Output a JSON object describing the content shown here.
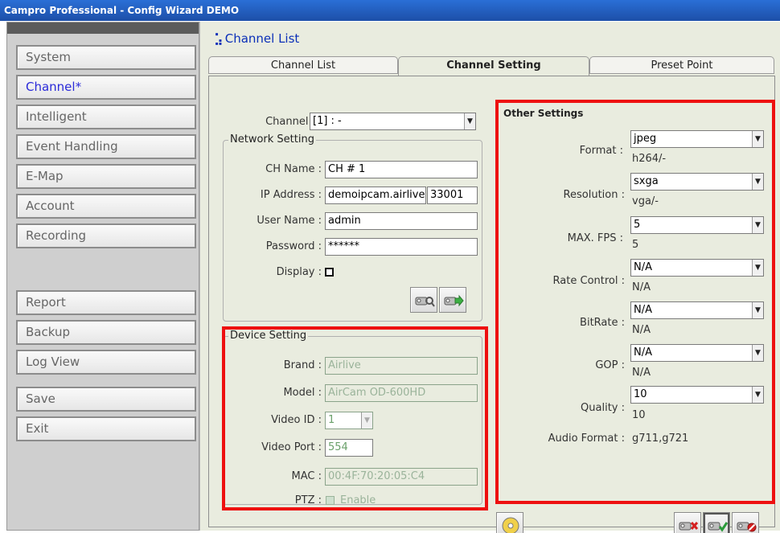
{
  "window": {
    "title": "Campro Professional - Config Wizard DEMO"
  },
  "sidebar": {
    "items": [
      {
        "label": "System"
      },
      {
        "label": "Channel*"
      },
      {
        "label": "Intelligent"
      },
      {
        "label": "Event Handling"
      },
      {
        "label": "E-Map"
      },
      {
        "label": "Account"
      },
      {
        "label": "Recording"
      },
      {
        "label": "Report"
      },
      {
        "label": "Backup"
      },
      {
        "label": "Log View"
      },
      {
        "label": "Save"
      },
      {
        "label": "Exit"
      }
    ]
  },
  "header": {
    "title": "Channel List",
    "icon": "network-icon"
  },
  "tabs": [
    {
      "label": "Channel List"
    },
    {
      "label": "Channel Setting"
    },
    {
      "label": "Preset Point"
    }
  ],
  "channel": {
    "label": "Channel :",
    "value": "[1] : -"
  },
  "network": {
    "legend": "Network Setting",
    "ch_name_label": "CH Name :",
    "ch_name": "CH # 1",
    "ip_label": "IP Address :",
    "ip": "demoipcam.airlive",
    "port": "33001",
    "user_label": "User Name :",
    "user": "admin",
    "password_label": "Password :",
    "password": "******",
    "display_label": "Display :"
  },
  "device": {
    "legend": "Device Setting",
    "brand_label": "Brand :",
    "brand": "Airlive",
    "model_label": "Model :",
    "model": "AirCam OD-600HD",
    "video_id_label": "Video ID :",
    "video_id": "1",
    "video_port_label": "Video Port :",
    "video_port": "554",
    "mac_label": "MAC :",
    "mac": "00:4F:70:20:05:C4",
    "ptz_label": "PTZ :",
    "ptz_enable": "Enable"
  },
  "other": {
    "legend": "Other Settings",
    "format_label": "Format :",
    "format": "jpeg",
    "format_sub": "h264/-",
    "resolution_label": "Resolution :",
    "resolution": "sxga",
    "resolution_sub": "vga/-",
    "fps_label": "MAX. FPS :",
    "fps": "5",
    "fps_sub": "5",
    "rate_label": "Rate Control :",
    "rate": "N/A",
    "rate_sub": "N/A",
    "bitrate_label": "BitRate :",
    "bitrate": "N/A",
    "bitrate_sub": "N/A",
    "gop_label": "GOP :",
    "gop": "N/A",
    "gop_sub": "N/A",
    "quality_label": "Quality :",
    "quality": "10",
    "quality_sub": "10",
    "audio_label": "Audio Format :",
    "audio": "g711,g721"
  },
  "colors": {
    "highlight": "#ee1010",
    "titlebar": "#1d4fa8",
    "accent_text": "#0a2fb8"
  }
}
